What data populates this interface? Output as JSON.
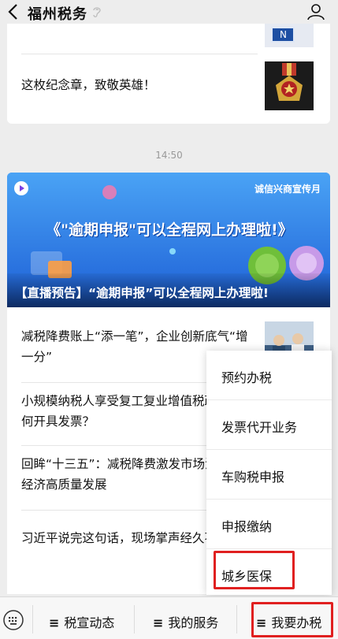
{
  "header": {
    "title": "福州税务"
  },
  "feed": {
    "card1_title": "这枚纪念章，致敬英雄！",
    "timestamp": "14:50",
    "banner_tag": "诚信兴商宣传月",
    "banner_headline": "《\"逾期申报\"可以全程网上办理啦!》",
    "banner_caption": "【直播预告】“逾期申报”可以全程网上办理啦!",
    "articles": [
      {
        "title": "减税降费账上“添一笔”，企业创新底气“增一分”"
      },
      {
        "title": "小规模纳税人享受复工复业增值税政策，如何开具发票？"
      },
      {
        "title": "回眸“十三五”：减税降费激发市场活力 促进经济高质量发展"
      },
      {
        "title": "习近平说完这句话，现场掌声经久不息"
      }
    ]
  },
  "menu": {
    "items": [
      {
        "label": "预约办税"
      },
      {
        "label": "发票代开业务"
      },
      {
        "label": "车购税申报"
      },
      {
        "label": "申报缴纳"
      },
      {
        "label": "城乡医保"
      }
    ]
  },
  "bottom_bar": {
    "tabs": [
      {
        "label": "税宣动态"
      },
      {
        "label": "我的服务"
      },
      {
        "label": "我要办税"
      }
    ],
    "menu_glyph": "≡"
  },
  "colors": {
    "highlight": "#e02020",
    "banner": "#2a6fe0"
  }
}
